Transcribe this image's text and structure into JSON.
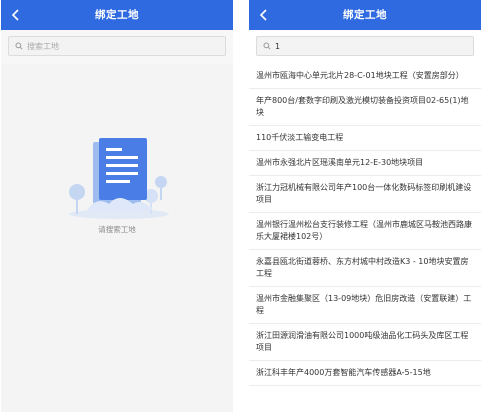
{
  "colors": {
    "header": "#2f6ae0",
    "illustration_blue": "#4a7de6"
  },
  "left": {
    "title": "绑定工地",
    "search": {
      "placeholder": "搜索工地",
      "value": ""
    },
    "empty_text": "请搜索工地"
  },
  "right": {
    "title": "绑定工地",
    "search": {
      "placeholder": "",
      "value": "1"
    },
    "results": [
      "温州市瓯海中心单元北片28-C-01地块工程（安置房部分）",
      "年产800台/套数字印刷及激光模切装备投资项目02-65(1)地块",
      "110千伏淡工输变电工程",
      "温州市永强北片区瑶溪南单元12-E-30地块项目",
      "浙江力冠机械有限公司年产100台一体化数码标签印刷机建设项目",
      "温州银行温州松台支行装修工程（温州市鹿城区马鞍池西路康乐大厦裙楼102号）",
      "永嘉县瓯北街道蓉桥、东方村城中村改造K3 - 10地块安置房工程",
      "温州市金融集聚区（13-09地块）危旧房改造（安置联建）工程",
      "浙江田源润滑油有限公司1000吨级油品化工码头及库区工程项目",
      "浙江科丰年产4000万套智能汽车传感器A-5-15地"
    ]
  },
  "icons": {
    "back": "chevron-left-icon",
    "search": "search-icon",
    "empty": "document-illustration"
  }
}
